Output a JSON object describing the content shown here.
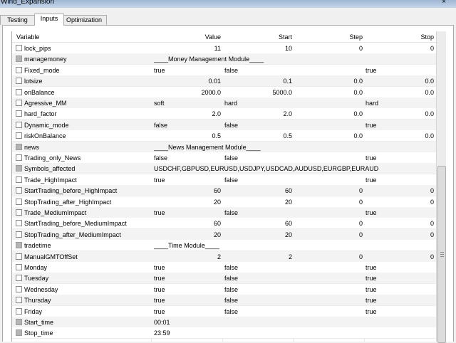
{
  "window": {
    "title": "Wind_Expansion",
    "close_glyph": "×"
  },
  "tabs": [
    {
      "label": "Testing"
    },
    {
      "label": "Inputs"
    },
    {
      "label": "Optimization"
    }
  ],
  "active_tab": "Inputs",
  "table": {
    "columns": {
      "variable": "Variable",
      "value": "Value",
      "start": "Start",
      "step": "Step",
      "stop": "Stop"
    },
    "rows": [
      {
        "name": "lock_pips",
        "cb": "box",
        "value": "11",
        "start": "10",
        "step": "0",
        "stop": "0"
      },
      {
        "name": "managemoney",
        "cb": "grey",
        "span": "____Money Management Module____"
      },
      {
        "name": "Fixed_mode",
        "cb": "box",
        "value": "true",
        "start": "false",
        "stop": "true",
        "align": "left"
      },
      {
        "name": "lotsize",
        "cb": "box",
        "value": "0.01",
        "start": "0.1",
        "step": "0.0",
        "stop": "0.0"
      },
      {
        "name": "onBalance",
        "cb": "box",
        "value": "2000.0",
        "start": "5000.0",
        "step": "0.0",
        "stop": "0.0"
      },
      {
        "name": "Agressive_MM",
        "cb": "box",
        "value": "soft",
        "start": "hard",
        "stop": "hard",
        "align": "left"
      },
      {
        "name": "hard_factor",
        "cb": "box",
        "value": "2.0",
        "start": "2.0",
        "step": "0.0",
        "stop": "0.0"
      },
      {
        "name": "Dynamic_mode",
        "cb": "box",
        "value": "false",
        "start": "false",
        "stop": "true",
        "align": "left"
      },
      {
        "name": "riskOnBalance",
        "cb": "box",
        "value": "0.5",
        "start": "0.5",
        "step": "0.0",
        "stop": "0.0"
      },
      {
        "name": "news",
        "cb": "grey",
        "span": "____News Management Module____"
      },
      {
        "name": "Trading_only_News",
        "cb": "box",
        "value": "false",
        "start": "false",
        "stop": "true",
        "align": "left"
      },
      {
        "name": "Symbols_affected",
        "cb": "grey",
        "span": "USDCHF,GBPUSD,EURUSD,USDJPY,USDCAD,AUDUSD,EURGBP,EURAUD"
      },
      {
        "name": "Trade_HighImpact",
        "cb": "box",
        "value": "true",
        "start": "false",
        "stop": "true",
        "align": "left"
      },
      {
        "name": "StartTrading_before_HighImpact",
        "cb": "box",
        "value": "60",
        "start": "60",
        "step": "0",
        "stop": "0"
      },
      {
        "name": "StopTrading_after_HighImpact",
        "cb": "box",
        "value": "20",
        "start": "20",
        "step": "0",
        "stop": "0"
      },
      {
        "name": "Trade_MediumImpact",
        "cb": "box",
        "value": "true",
        "start": "false",
        "stop": "true",
        "align": "left"
      },
      {
        "name": "StartTrading_before_MediumImpact",
        "cb": "box",
        "value": "60",
        "start": "60",
        "step": "0",
        "stop": "0"
      },
      {
        "name": "StopTrading_after_MediumImpact",
        "cb": "box",
        "value": "20",
        "start": "20",
        "step": "0",
        "stop": "0"
      },
      {
        "name": "tradetime",
        "cb": "grey",
        "span": "____Time Module____"
      },
      {
        "name": "ManualGMTOffSet",
        "cb": "box",
        "value": "2",
        "start": "2",
        "step": "0",
        "stop": "0"
      },
      {
        "name": "Monday",
        "cb": "box",
        "value": "true",
        "start": "false",
        "stop": "true",
        "align": "left"
      },
      {
        "name": "Tuesday",
        "cb": "box",
        "value": "true",
        "start": "false",
        "stop": "true",
        "align": "left"
      },
      {
        "name": "Wednesday",
        "cb": "box",
        "value": "true",
        "start": "false",
        "stop": "true",
        "align": "left"
      },
      {
        "name": "Thursday",
        "cb": "box",
        "value": "true",
        "start": "false",
        "stop": "true",
        "align": "left"
      },
      {
        "name": "Friday",
        "cb": "box",
        "value": "true",
        "start": "false",
        "stop": "true",
        "align": "left"
      },
      {
        "name": "Start_time",
        "cb": "grey",
        "span": "00:01"
      },
      {
        "name": "Stop_time",
        "cb": "grey",
        "span": "23:59"
      }
    ]
  }
}
